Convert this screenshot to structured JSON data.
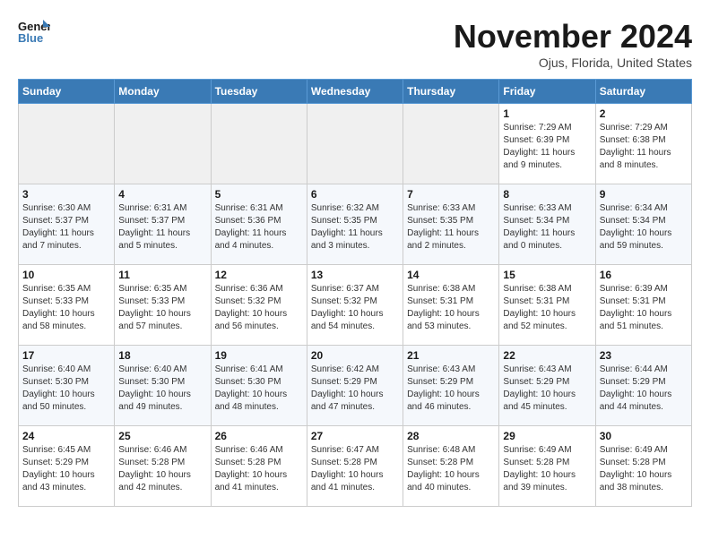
{
  "header": {
    "logo_line1": "General",
    "logo_line2": "Blue",
    "month": "November 2024",
    "location": "Ojus, Florida, United States"
  },
  "weekdays": [
    "Sunday",
    "Monday",
    "Tuesday",
    "Wednesday",
    "Thursday",
    "Friday",
    "Saturday"
  ],
  "weeks": [
    [
      {
        "day": "",
        "content": ""
      },
      {
        "day": "",
        "content": ""
      },
      {
        "day": "",
        "content": ""
      },
      {
        "day": "",
        "content": ""
      },
      {
        "day": "",
        "content": ""
      },
      {
        "day": "1",
        "content": "Sunrise: 7:29 AM\nSunset: 6:39 PM\nDaylight: 11 hours and 9 minutes."
      },
      {
        "day": "2",
        "content": "Sunrise: 7:29 AM\nSunset: 6:38 PM\nDaylight: 11 hours and 8 minutes."
      }
    ],
    [
      {
        "day": "3",
        "content": "Sunrise: 6:30 AM\nSunset: 5:37 PM\nDaylight: 11 hours and 7 minutes."
      },
      {
        "day": "4",
        "content": "Sunrise: 6:31 AM\nSunset: 5:37 PM\nDaylight: 11 hours and 5 minutes."
      },
      {
        "day": "5",
        "content": "Sunrise: 6:31 AM\nSunset: 5:36 PM\nDaylight: 11 hours and 4 minutes."
      },
      {
        "day": "6",
        "content": "Sunrise: 6:32 AM\nSunset: 5:35 PM\nDaylight: 11 hours and 3 minutes."
      },
      {
        "day": "7",
        "content": "Sunrise: 6:33 AM\nSunset: 5:35 PM\nDaylight: 11 hours and 2 minutes."
      },
      {
        "day": "8",
        "content": "Sunrise: 6:33 AM\nSunset: 5:34 PM\nDaylight: 11 hours and 0 minutes."
      },
      {
        "day": "9",
        "content": "Sunrise: 6:34 AM\nSunset: 5:34 PM\nDaylight: 10 hours and 59 minutes."
      }
    ],
    [
      {
        "day": "10",
        "content": "Sunrise: 6:35 AM\nSunset: 5:33 PM\nDaylight: 10 hours and 58 minutes."
      },
      {
        "day": "11",
        "content": "Sunrise: 6:35 AM\nSunset: 5:33 PM\nDaylight: 10 hours and 57 minutes."
      },
      {
        "day": "12",
        "content": "Sunrise: 6:36 AM\nSunset: 5:32 PM\nDaylight: 10 hours and 56 minutes."
      },
      {
        "day": "13",
        "content": "Sunrise: 6:37 AM\nSunset: 5:32 PM\nDaylight: 10 hours and 54 minutes."
      },
      {
        "day": "14",
        "content": "Sunrise: 6:38 AM\nSunset: 5:31 PM\nDaylight: 10 hours and 53 minutes."
      },
      {
        "day": "15",
        "content": "Sunrise: 6:38 AM\nSunset: 5:31 PM\nDaylight: 10 hours and 52 minutes."
      },
      {
        "day": "16",
        "content": "Sunrise: 6:39 AM\nSunset: 5:31 PM\nDaylight: 10 hours and 51 minutes."
      }
    ],
    [
      {
        "day": "17",
        "content": "Sunrise: 6:40 AM\nSunset: 5:30 PM\nDaylight: 10 hours and 50 minutes."
      },
      {
        "day": "18",
        "content": "Sunrise: 6:40 AM\nSunset: 5:30 PM\nDaylight: 10 hours and 49 minutes."
      },
      {
        "day": "19",
        "content": "Sunrise: 6:41 AM\nSunset: 5:30 PM\nDaylight: 10 hours and 48 minutes."
      },
      {
        "day": "20",
        "content": "Sunrise: 6:42 AM\nSunset: 5:29 PM\nDaylight: 10 hours and 47 minutes."
      },
      {
        "day": "21",
        "content": "Sunrise: 6:43 AM\nSunset: 5:29 PM\nDaylight: 10 hours and 46 minutes."
      },
      {
        "day": "22",
        "content": "Sunrise: 6:43 AM\nSunset: 5:29 PM\nDaylight: 10 hours and 45 minutes."
      },
      {
        "day": "23",
        "content": "Sunrise: 6:44 AM\nSunset: 5:29 PM\nDaylight: 10 hours and 44 minutes."
      }
    ],
    [
      {
        "day": "24",
        "content": "Sunrise: 6:45 AM\nSunset: 5:29 PM\nDaylight: 10 hours and 43 minutes."
      },
      {
        "day": "25",
        "content": "Sunrise: 6:46 AM\nSunset: 5:28 PM\nDaylight: 10 hours and 42 minutes."
      },
      {
        "day": "26",
        "content": "Sunrise: 6:46 AM\nSunset: 5:28 PM\nDaylight: 10 hours and 41 minutes."
      },
      {
        "day": "27",
        "content": "Sunrise: 6:47 AM\nSunset: 5:28 PM\nDaylight: 10 hours and 41 minutes."
      },
      {
        "day": "28",
        "content": "Sunrise: 6:48 AM\nSunset: 5:28 PM\nDaylight: 10 hours and 40 minutes."
      },
      {
        "day": "29",
        "content": "Sunrise: 6:49 AM\nSunset: 5:28 PM\nDaylight: 10 hours and 39 minutes."
      },
      {
        "day": "30",
        "content": "Sunrise: 6:49 AM\nSunset: 5:28 PM\nDaylight: 10 hours and 38 minutes."
      }
    ]
  ]
}
